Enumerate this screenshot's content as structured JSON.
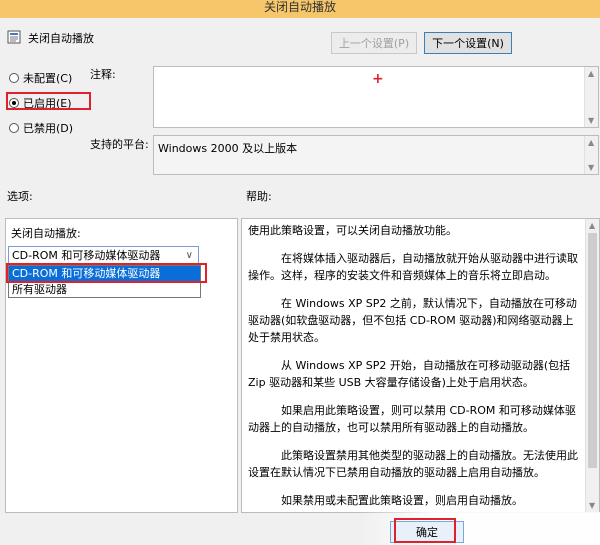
{
  "window": {
    "title": "关闭自动播放"
  },
  "header": {
    "title": "关闭自动播放",
    "icon": "policy-document-icon"
  },
  "nav": {
    "prev_label": "上一个设置(P)",
    "next_label": "下一个设置(N)"
  },
  "state": {
    "options": [
      {
        "label": "未配置(C)",
        "checked": false
      },
      {
        "label": "已启用(E)",
        "checked": true
      },
      {
        "label": "已禁用(D)",
        "checked": false
      }
    ]
  },
  "comment": {
    "label": "注释:",
    "value": ""
  },
  "platform": {
    "label": "支持的平台:",
    "value": "Windows 2000 及以上版本"
  },
  "sections": {
    "options_label": "选项:",
    "help_label": "帮助:"
  },
  "options_panel": {
    "field_label": "关闭自动播放:",
    "selected": "CD-ROM 和可移动媒体驱动器",
    "dropdown_options": [
      "CD-ROM 和可移动媒体驱动器",
      "所有驱动器"
    ]
  },
  "help": {
    "paragraphs": [
      "使用此策略设置，可以关闭自动播放功能。",
      "在将媒体插入驱动器后，自动播放就开始从驱动器中进行读取操作。这样，程序的安装文件和音频媒体上的音乐将立即启动。",
      "在 Windows XP SP2 之前，默认情况下，自动播放在可移动驱动器(如软盘驱动器，但不包括 CD-ROM 驱动器)和网络驱动器上处于禁用状态。",
      "从 Windows XP SP2 开始，自动播放在可移动驱动器(包括 Zip 驱动器和某些 USB 大容量存储设备)上处于启用状态。",
      "如果启用此策略设置，则可以禁用 CD-ROM 和可移动媒体驱动器上的自动播放，也可以禁用所有驱动器上的自动播放。",
      "此策略设置禁用其他类型的驱动器上的自动播放。无法使用此设置在默认情况下已禁用自动播放的驱动器上启用自动播放。",
      "如果禁用或未配置此策略设置，则启用自动播放。"
    ]
  },
  "footer": {
    "ok_label": "确定"
  },
  "colors": {
    "titlebar": "#f6c66a",
    "highlight": "#e0202a",
    "selection": "#0a6ed8"
  }
}
